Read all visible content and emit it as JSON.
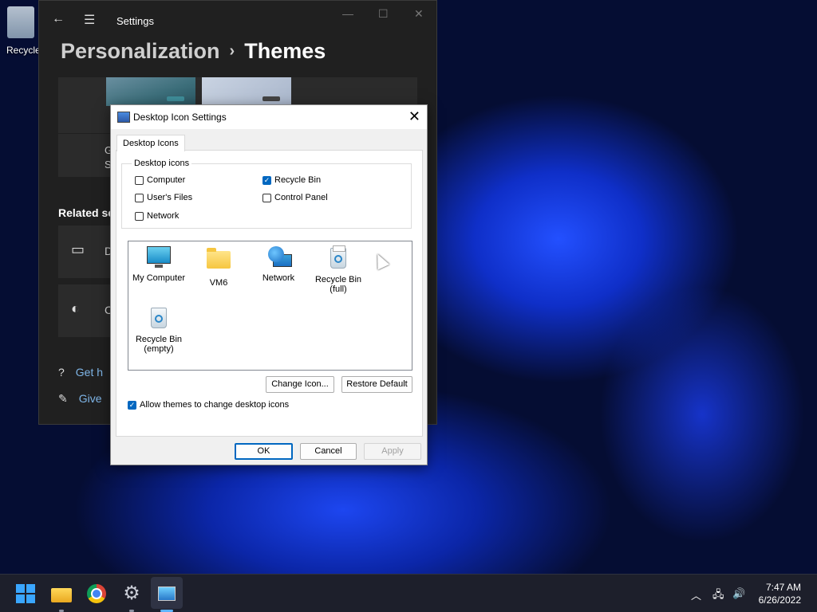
{
  "desktop": {
    "recycle_label": "Recycle"
  },
  "settings": {
    "title": "Settings",
    "breadcrumb_parent": "Personalization",
    "breadcrumb_sep": "›",
    "breadcrumb_current": "Themes",
    "card_text": "G\nS",
    "related_heading": "Related se",
    "related_items": [
      {
        "label": "D"
      },
      {
        "label": "C"
      }
    ],
    "links": [
      {
        "label": "Get h"
      },
      {
        "label": "Give"
      }
    ]
  },
  "dialog": {
    "title": "Desktop Icon Settings",
    "tab": "Desktop Icons",
    "group_label": "Desktop icons",
    "checkboxes": {
      "computer": {
        "label": "Computer",
        "checked": false
      },
      "users_files": {
        "label": "User's Files",
        "checked": false
      },
      "network": {
        "label": "Network",
        "checked": false
      },
      "recycle_bin": {
        "label": "Recycle Bin",
        "checked": true
      },
      "control_panel": {
        "label": "Control Panel",
        "checked": false
      }
    },
    "icons": [
      {
        "label": "My Computer"
      },
      {
        "label": "VM6"
      },
      {
        "label": "Network"
      },
      {
        "label": "Recycle Bin\n(full)"
      },
      {
        "label": "Recycle Bin\n(empty)"
      }
    ],
    "change_icon": "Change Icon...",
    "restore_default": "Restore Default",
    "allow_themes": {
      "label": "Allow themes to change desktop icons",
      "checked": true
    },
    "ok": "OK",
    "cancel": "Cancel",
    "apply": "Apply"
  },
  "taskbar": {
    "time": "7:47 AM",
    "date": "6/26/2022",
    "apps": [
      "start",
      "file-explorer",
      "chrome",
      "settings",
      "desktop-icon-settings"
    ]
  }
}
